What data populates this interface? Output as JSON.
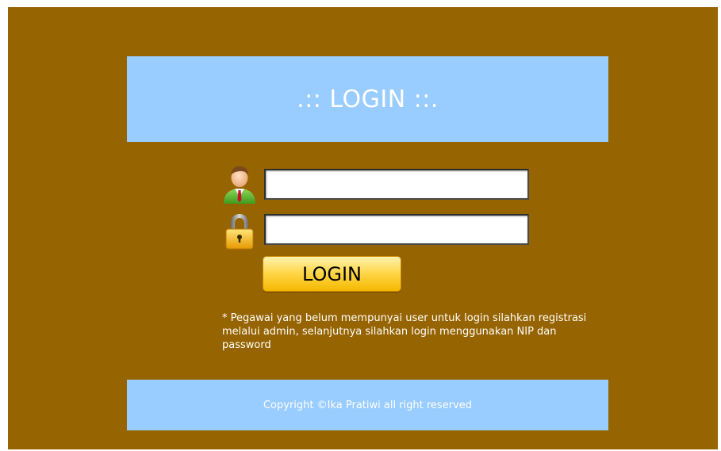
{
  "header": {
    "title": ".:: LOGIN ::."
  },
  "form": {
    "username": {
      "icon": "user-icon",
      "value": "",
      "placeholder": ""
    },
    "password": {
      "icon": "lock-icon",
      "value": "",
      "placeholder": ""
    },
    "login_button_label": "LOGIN"
  },
  "note": {
    "text": "* Pegawai yang belum mempunyai user untuk login silahkan registrasi melalui admin, selanjutnya silahkan login menggunakan NIP dan password"
  },
  "footer": {
    "copyright": "Copyright ©Ika Pratiwi all right reserved"
  },
  "colors": {
    "background": "#966400",
    "banner": "#99ccff",
    "button": "#ffd84d"
  }
}
